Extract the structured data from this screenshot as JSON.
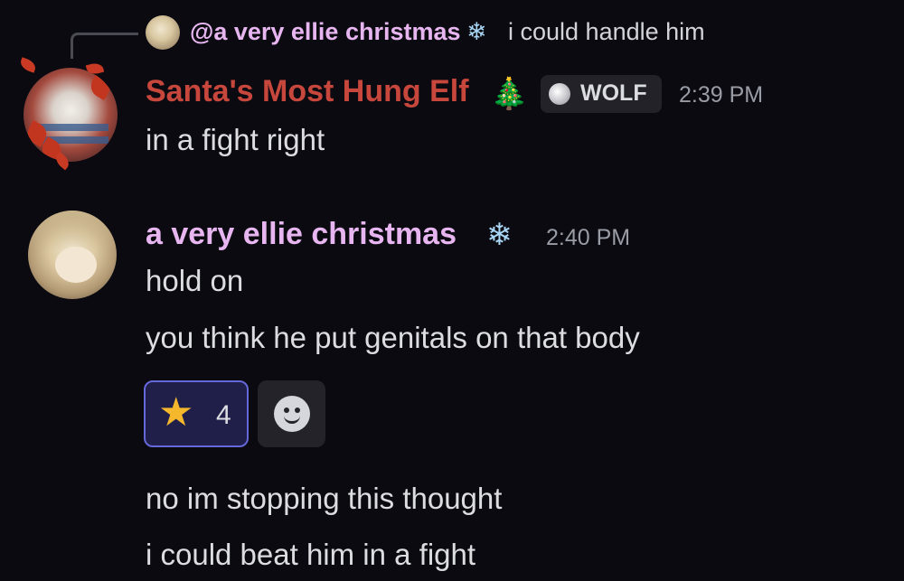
{
  "reply": {
    "author": "@a very ellie christmas",
    "author_emoji": "❄",
    "text": "i could handle him"
  },
  "messages": [
    {
      "author": "Santa's Most Hung Elf",
      "author_emoji": "🎄",
      "role_tag": "WOLF",
      "timestamp": "2:39 PM",
      "lines": [
        "in a fight right"
      ]
    },
    {
      "author": "a very ellie christmas",
      "author_emoji": "❄",
      "timestamp": "2:40 PM",
      "lines": [
        "hold on",
        "you think he put genitals on that body"
      ],
      "reaction": {
        "emoji": "★",
        "count": "4"
      }
    },
    {
      "lines": [
        "no im stopping this thought",
        "i could beat him in a fight"
      ]
    }
  ],
  "icons": {
    "reply_connector": "reply-line",
    "add_reaction": "smile-icon",
    "role": "wolf-icon"
  },
  "colors": {
    "background": "#0b0a10",
    "santa_name": "#c8473d",
    "ellie_name": "#e7b6f0",
    "reaction_border": "#6568d8",
    "reaction_bg": "#1f1f4a"
  }
}
